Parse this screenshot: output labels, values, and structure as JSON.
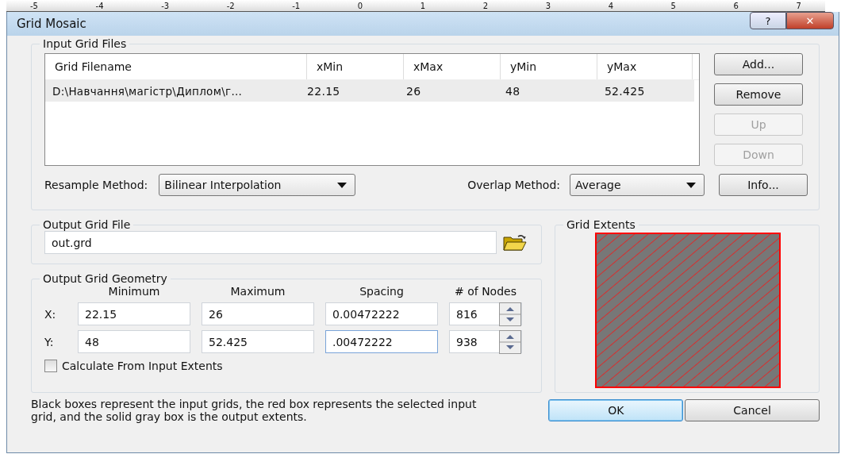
{
  "ruler": {
    "labels": [
      "-5",
      "-4",
      "-3",
      "-2",
      "-1",
      "0",
      "1",
      "2",
      "3",
      "4",
      "5",
      "6",
      "7"
    ]
  },
  "window": {
    "title": "Grid Mosaic",
    "help": "?",
    "close": "✕"
  },
  "input_files": {
    "title": "Input Grid Files",
    "columns": [
      "Grid Filename",
      "xMin",
      "xMax",
      "yMin",
      "yMax"
    ],
    "rows": [
      {
        "cells": [
          "D:\\Навчання\\магістр\\Диплом\\г...",
          "22.15",
          "26",
          "48",
          "52.425"
        ],
        "selected": true
      }
    ],
    "buttons": [
      {
        "label": "Add...",
        "disabled": false
      },
      {
        "label": "Remove",
        "disabled": false
      },
      {
        "label": "Up",
        "disabled": true
      },
      {
        "label": "Down",
        "disabled": true
      },
      {
        "label": "Info...",
        "disabled": false
      }
    ],
    "resample": {
      "label": "Resample Method:",
      "value": "Bilinear Interpolation"
    },
    "overlap": {
      "label": "Overlap Method:",
      "value": "Average"
    }
  },
  "output_file": {
    "title": "Output Grid File",
    "value": "out.grd"
  },
  "geometry": {
    "title": "Output Grid Geometry",
    "columns": [
      "Minimum",
      "Maximum",
      "Spacing",
      "# of Nodes"
    ],
    "rows": [
      {
        "label": "X:",
        "values": [
          "22.15",
          "26",
          "0.00472222"
        ],
        "nodes": "816",
        "focused": false
      },
      {
        "label": "Y:",
        "values": [
          "48",
          "52.425",
          ".00472222"
        ],
        "nodes": "938",
        "focused": true
      }
    ],
    "checkbox": {
      "label": "Calculate From Input Extents",
      "checked": false
    }
  },
  "extents": {
    "title": "Grid Extents"
  },
  "note": "Black boxes represent the input grids, the red box represents the selected input grid, and the solid gray box is the output extents.",
  "buttons": [
    {
      "label": "OK",
      "default": true
    },
    {
      "label": "Cancel",
      "default": false
    }
  ]
}
